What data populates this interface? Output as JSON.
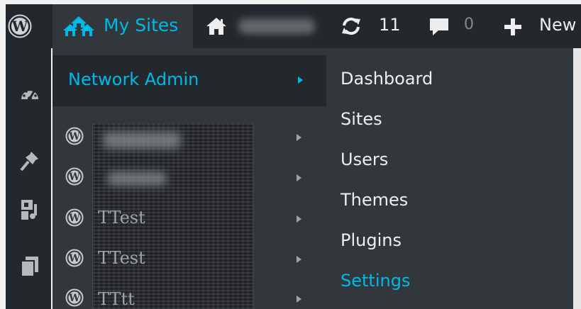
{
  "admin_bar": {
    "wp_logo_icon": "wordpress-logo-icon",
    "my_sites_label": "My Sites",
    "my_sites_icon": "network-houses-icon",
    "home_icon": "home-icon",
    "updates_count": "11",
    "updates_icon": "refresh-icon",
    "comments_count": "0",
    "comments_icon": "comment-bubble-icon",
    "new_label": "New",
    "new_icon": "plus-icon"
  },
  "left_rail": {
    "icons": [
      "dashboard-gauge-icon",
      "pushpin-icon",
      "media-icon",
      "pages-icon"
    ]
  },
  "my_sites_menu": {
    "network_admin_label": "Network Admin",
    "sites": [
      {
        "label": "",
        "icon": "wordpress-logo-icon"
      },
      {
        "label": "",
        "icon": "wordpress-logo-icon"
      },
      {
        "label": "TTest",
        "icon": "wordpress-logo-icon"
      },
      {
        "label": "TTest",
        "icon": "wordpress-logo-icon"
      },
      {
        "label": "TTtt",
        "icon": "wordpress-logo-icon"
      }
    ]
  },
  "network_admin_submenu": {
    "items": [
      {
        "label": "Dashboard"
      },
      {
        "label": "Sites"
      },
      {
        "label": "Users"
      },
      {
        "label": "Themes"
      },
      {
        "label": "Plugins"
      },
      {
        "label": "Settings",
        "active": true
      }
    ]
  },
  "colors": {
    "bar_bg": "#23282d",
    "menu_bg": "#32373c",
    "accent": "#00b9eb",
    "text": "#eeeeee"
  }
}
